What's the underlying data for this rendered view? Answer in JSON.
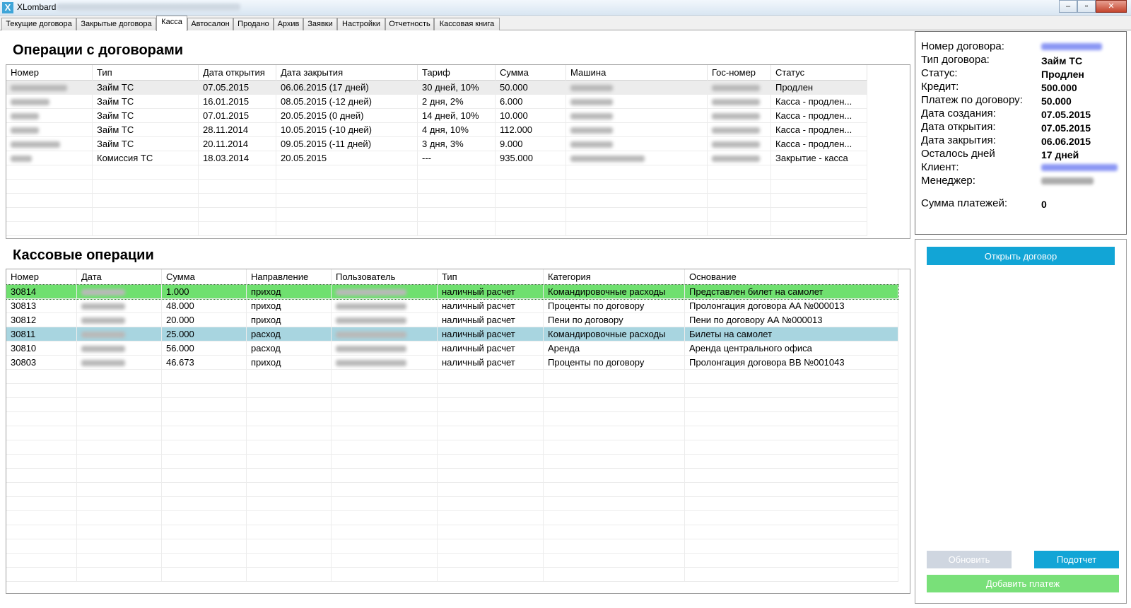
{
  "window": {
    "title": "XLombard",
    "icon": "X",
    "minimize": "–",
    "maximize": "▫",
    "close": "✕"
  },
  "tabs": [
    "Текущие договора",
    "Закрытые договора",
    "Касса",
    "Автосалон",
    "Продано",
    "Архив",
    "Заявки",
    "Настройки",
    "Отчетность",
    "Кассовая книга"
  ],
  "contracts": {
    "title": "Операции с договорами",
    "columns": [
      "Номер",
      "Тип",
      "Дата открытия",
      "Дата закрытия",
      "Тариф",
      "Сумма",
      "Машина",
      "Гос-номер",
      "Статус"
    ],
    "rows": [
      {
        "type": "Займ ТС",
        "opened": "07.05.2015",
        "closed": "06.06.2015 (17 дней)",
        "tariff": "30 дней, 10%",
        "sum": "50.000",
        "status": "Продлен"
      },
      {
        "type": "Займ ТС",
        "opened": "16.01.2015",
        "closed": "08.05.2015 (-12 дней)",
        "tariff": "2 дня, 2%",
        "sum": "6.000",
        "status": "Касса - продлен..."
      },
      {
        "type": "Займ ТС",
        "opened": "07.01.2015",
        "closed": "20.05.2015 (0 дней)",
        "tariff": "14 дней, 10%",
        "sum": "10.000",
        "status": "Касса - продлен..."
      },
      {
        "type": "Займ ТС",
        "opened": "28.11.2014",
        "closed": "10.05.2015 (-10 дней)",
        "tariff": "4 дня, 10%",
        "sum": "112.000",
        "status": "Касса - продлен..."
      },
      {
        "type": "Займ ТС",
        "opened": "20.11.2014",
        "closed": "09.05.2015 (-11 дней)",
        "tariff": "3 дня, 3%",
        "sum": "9.000",
        "status": "Касса - продлен..."
      },
      {
        "type": "Комиссия ТС",
        "opened": "18.03.2014",
        "closed": "20.05.2015",
        "tariff": "---",
        "sum": "935.000",
        "status": "Закрытие - касса"
      }
    ]
  },
  "cash": {
    "title": "Кассовые операции",
    "columns": [
      "Номер",
      "Дата",
      "Сумма",
      "Направление",
      "Пользователь",
      "Тип",
      "Категория",
      "Основание"
    ],
    "rows": [
      {
        "num": "30814",
        "sum": "1.000",
        "dir": "приход",
        "type": "наличный расчет",
        "cat": "Командировочные расходы",
        "basis": "Представлен билет на самолет"
      },
      {
        "num": "30813",
        "sum": "48.000",
        "dir": "приход",
        "type": "наличный расчет",
        "cat": "Проценты по договору",
        "basis": "Пролонгация договора АА №000013"
      },
      {
        "num": "30812",
        "sum": "20.000",
        "dir": "приход",
        "type": "наличный расчет",
        "cat": "Пени по договору",
        "basis": "Пени по договору АА №000013"
      },
      {
        "num": "30811",
        "sum": "25.000",
        "dir": "расход",
        "type": "наличный расчет",
        "cat": "Командировочные расходы",
        "basis": "Билеты на самолет"
      },
      {
        "num": "30810",
        "sum": "56.000",
        "dir": "расход",
        "type": "наличный расчет",
        "cat": "Аренда",
        "basis": "Аренда центрального офиса"
      },
      {
        "num": "30803",
        "sum": "46.673",
        "dir": "приход",
        "type": "наличный расчет",
        "cat": "Проценты по договору",
        "basis": "Пролонгация договора ВВ №001043"
      }
    ]
  },
  "info": {
    "labels": {
      "contract_no": "Номер договора:",
      "contract_type": "Тип договора:",
      "status": "Статус:",
      "credit": "Кредит:",
      "payment": "Платеж по договору:",
      "created": "Дата создания:",
      "opened": "Дата открытия:",
      "closed": "Дата закрытия:",
      "days_left": "Осталось дней",
      "client": "Клиент:",
      "manager": "Менеджер:",
      "payments_sum": "Сумма платежей:"
    },
    "values": {
      "contract_type": "Займ ТС",
      "status": "Продлен",
      "credit": "500.000",
      "payment": "50.000",
      "created": "07.05.2015",
      "opened": "07.05.2015",
      "closed": "06.06.2015",
      "days_left": "17 дней",
      "payments_sum": "0"
    }
  },
  "buttons": {
    "open_contract": "Открыть договор",
    "refresh": "Обновить",
    "subreport": "Подотчет",
    "add_payment": "Добавить платеж"
  },
  "colors": {
    "accent_blue": "#12a5d6",
    "green_row": "#6fe06f",
    "blue_row": "#a8d5e0",
    "disabled": "#cfd6e0",
    "green_button": "#79e079"
  }
}
